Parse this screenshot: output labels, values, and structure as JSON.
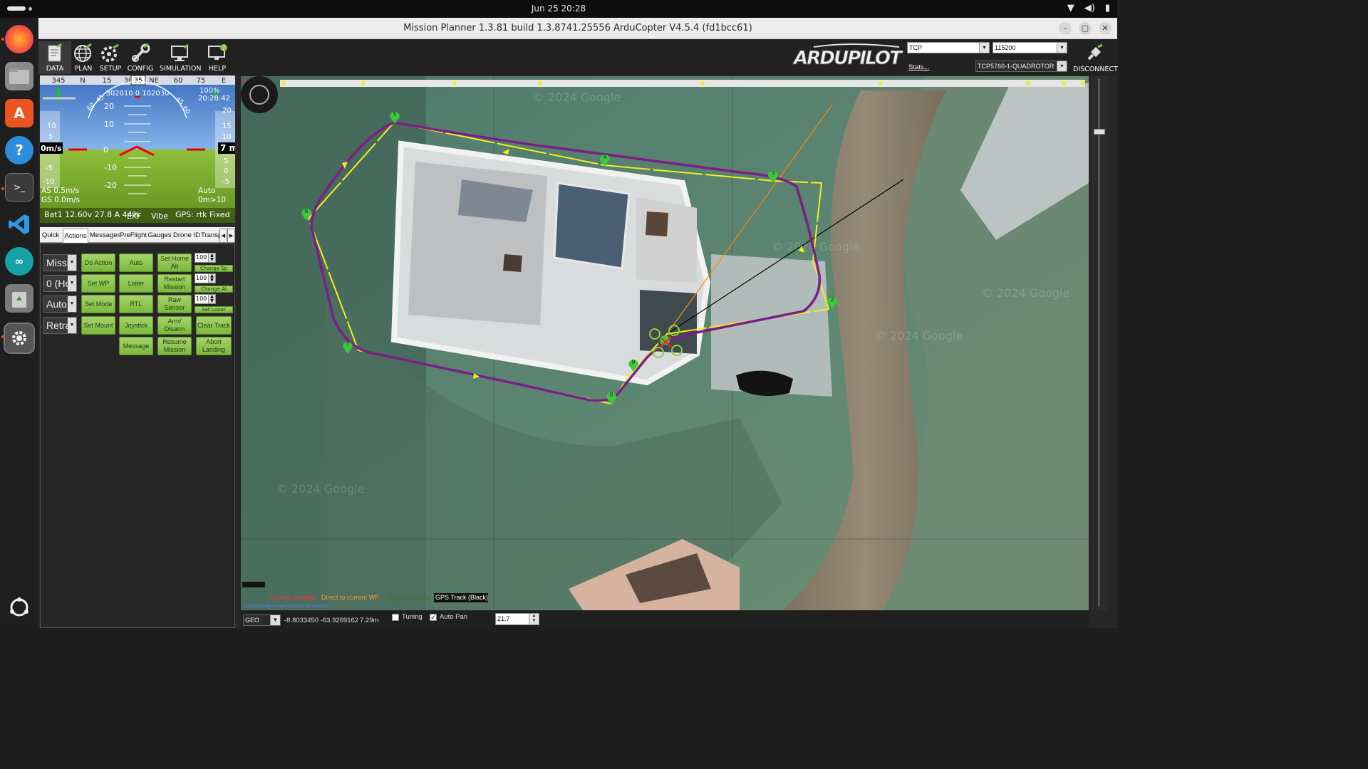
{
  "system": {
    "clock": "Jun 25  20:28"
  },
  "window": {
    "title": "Mission Planner 1.3.81 build 1.3.8741.25556 ArduCopter V4.5.4 (fd1bcc61)"
  },
  "toolbar": {
    "buttons": [
      {
        "label": "DATA",
        "icon": "data-icon"
      },
      {
        "label": "PLAN",
        "icon": "globe-icon"
      },
      {
        "label": "SETUP",
        "icon": "setup-icon"
      },
      {
        "label": "CONFIG",
        "icon": "config-icon"
      },
      {
        "label": "SIMULATION",
        "icon": "simulation-icon"
      },
      {
        "label": "HELP",
        "icon": "help-icon"
      }
    ],
    "logo_text": "ARDUPILOT",
    "connection_type": "TCP",
    "baud_rate": "115200",
    "stats_link": "Stats...",
    "vehicle": "TCP5760-1-QUADROTOR",
    "disconnect_label": "DISCONNECT"
  },
  "hud": {
    "heading_ticks": [
      "345",
      "N",
      "15",
      "30",
      "NE",
      "60",
      "75",
      "E"
    ],
    "heading_value": "35",
    "time": "20:28:42",
    "battery_percent": "100%",
    "speed_label": "0m/s",
    "alt_label": "7 m",
    "speed_ticks": [
      "10",
      "5",
      "0",
      "-5",
      "-10"
    ],
    "alt_ticks": [
      "20",
      "15",
      "10",
      "5",
      "0",
      "-5"
    ],
    "pitch_ticks": [
      "20",
      "10",
      "0",
      "-10",
      "-20"
    ],
    "roll_scale": "302010 0 102030",
    "roll_side": [
      "60",
      "45",
      "45",
      "60"
    ],
    "airspeed": "AS 0.5m/s",
    "groundspeed": "GS 0.0m/s",
    "mode": "Auto",
    "wp_dist": "0m>10",
    "battery": "Bat1 12.60v 27.8 A 44%",
    "ekf": "EKF",
    "vibe": "Vibe",
    "gps": "GPS: rtk Fixed",
    "colors": {
      "sky": "#5a8fd3",
      "ground": "#7fae2c"
    }
  },
  "tabs": [
    "Quick",
    "Actions",
    "Messages",
    "PreFlight",
    "Gauges",
    "Drone ID",
    "Transponder"
  ],
  "actions": {
    "combos": [
      "Missi",
      "0 (Ho",
      "Auto",
      "Retra"
    ],
    "col1": [
      "Do Action",
      "Set WP",
      "Set Mode",
      "Set Mount"
    ],
    "col2": [
      "Auto",
      "Loiter",
      "RTL",
      "Joystick",
      "Message"
    ],
    "col3": [
      "Set Home Alt",
      "Restart Mission",
      "Raw Sensor",
      "Arm/ Disarm",
      "Resume Mission"
    ],
    "col4": [
      "Clear Track",
      "Abort Landing"
    ],
    "spins": [
      "100",
      "100",
      "100"
    ],
    "half_buttons": [
      "Change Sp",
      "Change Al",
      "Set Loiter"
    ]
  },
  "map": {
    "watermarks": [
      "© 2024 Google",
      "© 2024 Google",
      "© 2024 Google",
      "© 2024 Google",
      "© 2024 Google"
    ],
    "waypoints": [
      "1",
      "2",
      "3",
      "4",
      "5",
      "6",
      "7",
      "8",
      "9"
    ],
    "legend": {
      "current_heading": "Current Heading",
      "direct_wp": "Direct to current WP",
      "target_heading": "Target Heading",
      "gps_track": "GPS Track (Black)"
    },
    "copyright": "©2024 Google  Imagery ©2024 TerraMetrics",
    "colors": {
      "route": "#7b1f86",
      "path": "#f2ef1a",
      "heading": "#ff8a00",
      "track": "#000000"
    }
  },
  "mapbar": {
    "coord_mode": "GEO",
    "coords": "-8.8033450 -63.9269162",
    "altitude": "7.29m",
    "tuning_label": "Tuning",
    "tuning_checked": false,
    "autopan_label": "Auto Pan",
    "autopan_checked": true,
    "zoom": "21.7"
  }
}
